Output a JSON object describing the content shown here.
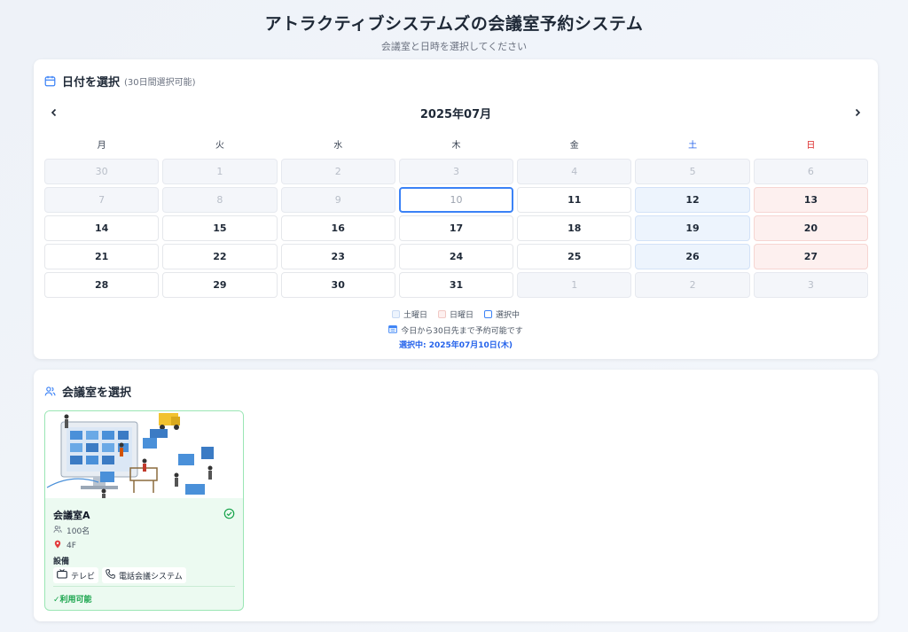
{
  "header": {
    "title": "アトラクティブシステムズの会議室予約システム",
    "subtitle": "会議室と日時を選択してください"
  },
  "date_section": {
    "icon": "calendar-icon",
    "title": "日付を選択",
    "note": "(30日間選択可能)",
    "month_label": "2025年07月",
    "prev_icon": "chevron-left-icon",
    "next_icon": "chevron-right-icon",
    "weekdays": [
      "月",
      "火",
      "水",
      "木",
      "金",
      "土",
      "日"
    ],
    "days": [
      {
        "label": "30",
        "state": "disabled"
      },
      {
        "label": "1",
        "state": "disabled"
      },
      {
        "label": "2",
        "state": "disabled"
      },
      {
        "label": "3",
        "state": "disabled"
      },
      {
        "label": "4",
        "state": "disabled"
      },
      {
        "label": "5",
        "state": "disabled"
      },
      {
        "label": "6",
        "state": "disabled"
      },
      {
        "label": "7",
        "state": "disabled"
      },
      {
        "label": "8",
        "state": "disabled"
      },
      {
        "label": "9",
        "state": "disabled"
      },
      {
        "label": "10",
        "state": "selected"
      },
      {
        "label": "11",
        "state": "available"
      },
      {
        "label": "12",
        "state": "sat"
      },
      {
        "label": "13",
        "state": "sun"
      },
      {
        "label": "14",
        "state": "available"
      },
      {
        "label": "15",
        "state": "available"
      },
      {
        "label": "16",
        "state": "available"
      },
      {
        "label": "17",
        "state": "available"
      },
      {
        "label": "18",
        "state": "available"
      },
      {
        "label": "19",
        "state": "sat"
      },
      {
        "label": "20",
        "state": "sun"
      },
      {
        "label": "21",
        "state": "available"
      },
      {
        "label": "22",
        "state": "available"
      },
      {
        "label": "23",
        "state": "available"
      },
      {
        "label": "24",
        "state": "available"
      },
      {
        "label": "25",
        "state": "available"
      },
      {
        "label": "26",
        "state": "sat"
      },
      {
        "label": "27",
        "state": "sun"
      },
      {
        "label": "28",
        "state": "available"
      },
      {
        "label": "29",
        "state": "available"
      },
      {
        "label": "30",
        "state": "available"
      },
      {
        "label": "31",
        "state": "available"
      },
      {
        "label": "1",
        "state": "disabled"
      },
      {
        "label": "2",
        "state": "disabled"
      },
      {
        "label": "3",
        "state": "disabled"
      }
    ],
    "legend": {
      "saturday": "土曜日",
      "sunday": "日曜日",
      "selected": "選択中"
    },
    "range_note": "今日から30日先まで予約可能です",
    "selected_note": "選択中: 2025年07月10日(木)"
  },
  "room_section": {
    "icon": "users-icon",
    "title": "会議室を選択",
    "rooms": [
      {
        "name": "会議室A",
        "capacity": "100名",
        "floor": "4F",
        "equipment_label": "設備",
        "equipment": [
          {
            "icon": "tv-icon",
            "label": "テレビ"
          },
          {
            "icon": "phone-icon",
            "label": "電話会議システム"
          }
        ],
        "status": "✓利用可能"
      }
    ]
  },
  "colors": {
    "accent": "#3b82f6",
    "saturday": "#2563eb",
    "sunday": "#dc2626",
    "available": "#16a34a"
  }
}
